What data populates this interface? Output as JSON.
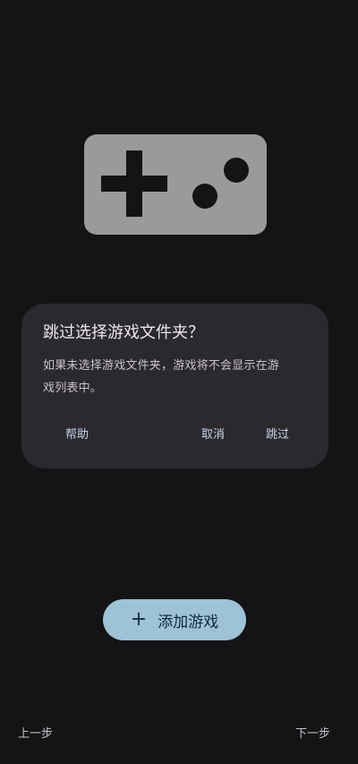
{
  "illustration": {
    "icon": "gamepad-icon",
    "color": "#9b999c"
  },
  "dialog": {
    "title": "跳过选择游戏文件夹？",
    "body_line1": "如果未选择游戏文件夹，游戏将不会显示在游",
    "body_line2": "戏列表中。",
    "help_label": "帮助",
    "cancel_label": "取消",
    "skip_label": "跳过",
    "accent": "#c7d3ea"
  },
  "add_game": {
    "icon": "plus-icon",
    "plus_glyph": "+",
    "label": "添加游戏",
    "color": "#9ec2d6"
  },
  "nav": {
    "prev_label": "上一步",
    "next_label": "下一步"
  },
  "colors": {
    "background": "#141316",
    "dialog_bg": "#2b292d"
  }
}
